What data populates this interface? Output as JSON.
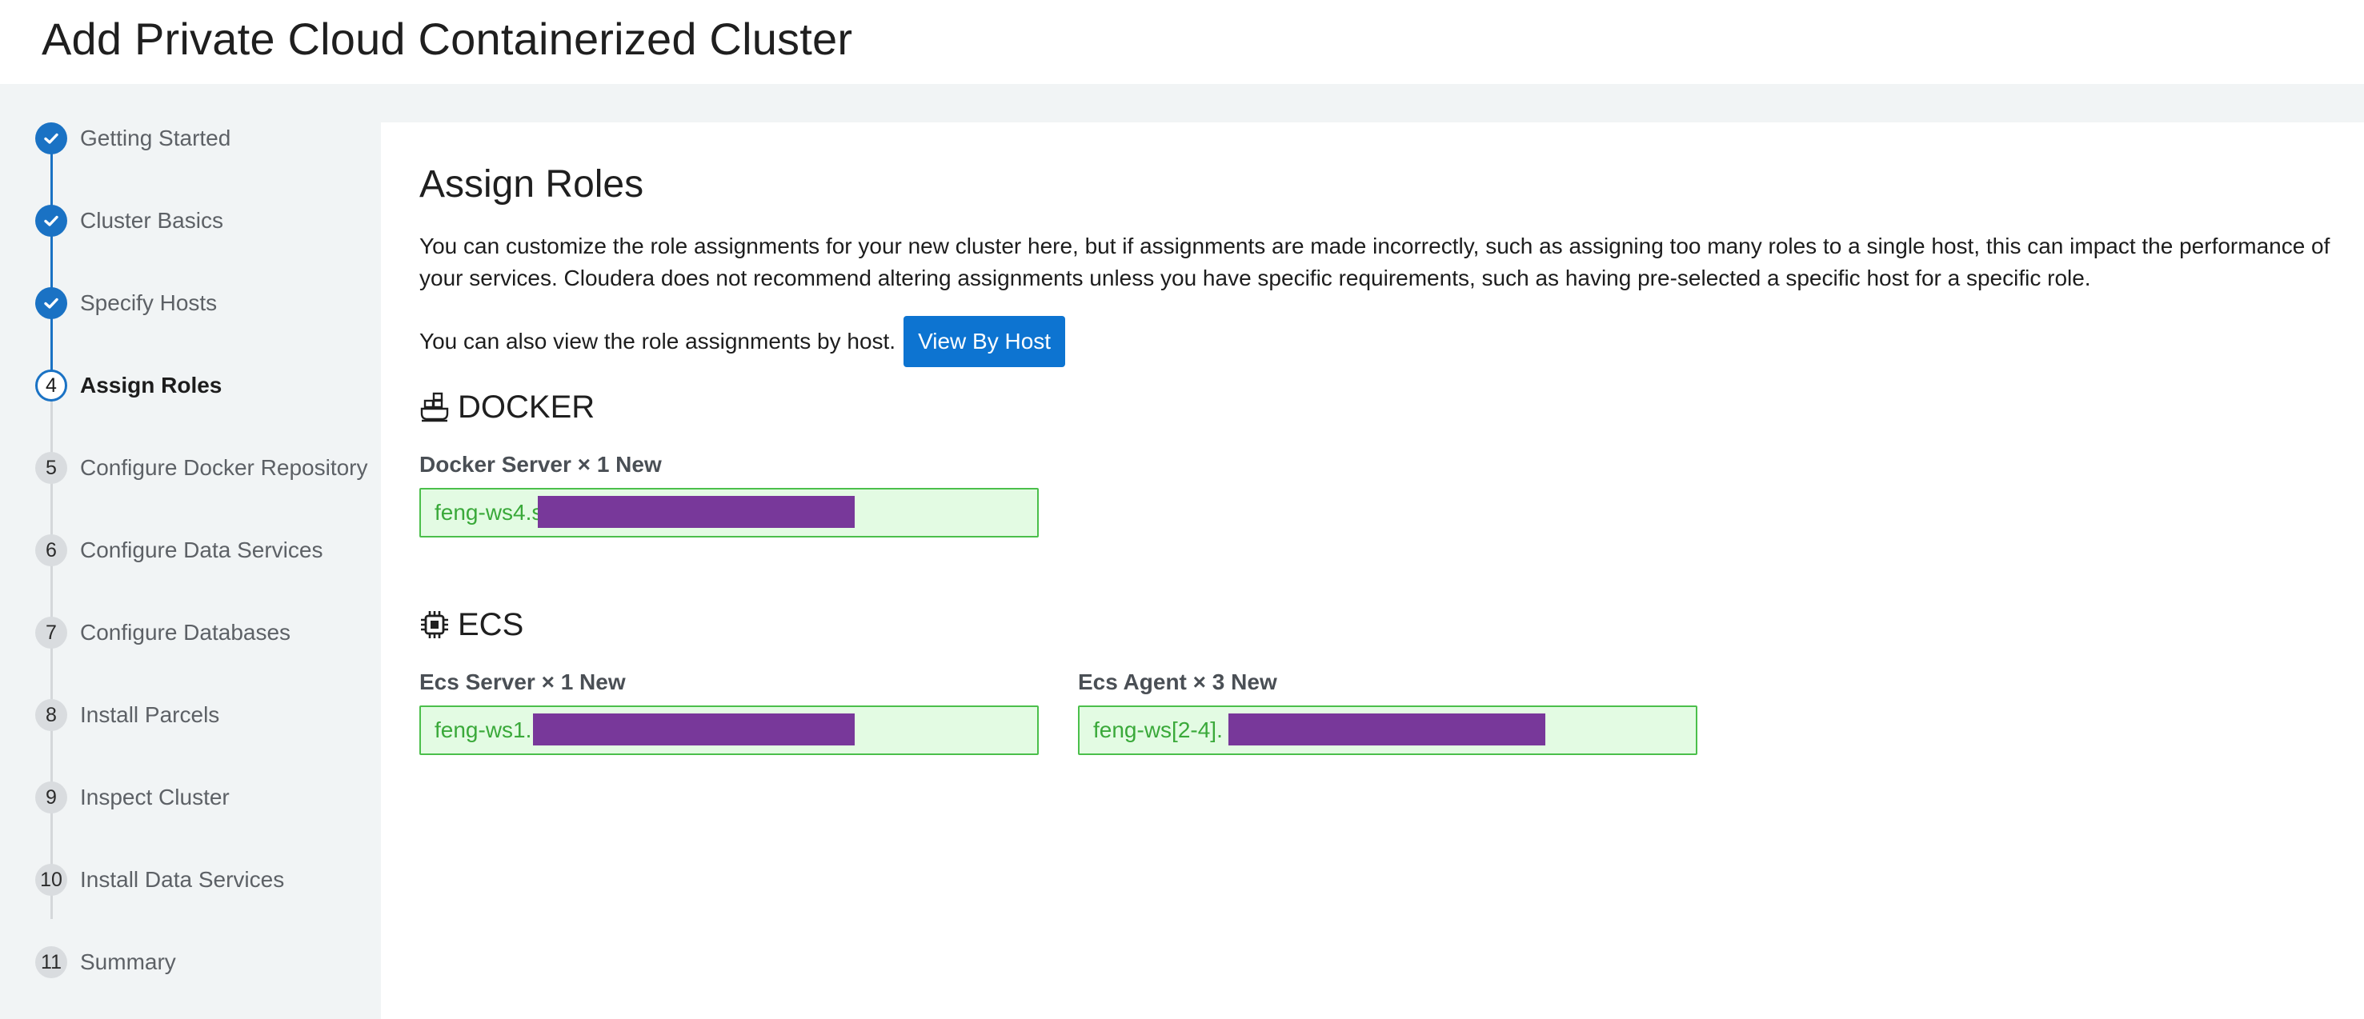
{
  "page": {
    "title": "Add Private Cloud Containerized Cluster"
  },
  "steps": [
    {
      "number": "1",
      "label": "Getting Started",
      "status": "done"
    },
    {
      "number": "2",
      "label": "Cluster Basics",
      "status": "done"
    },
    {
      "number": "3",
      "label": "Specify Hosts",
      "status": "done"
    },
    {
      "number": "4",
      "label": "Assign Roles",
      "status": "current"
    },
    {
      "number": "5",
      "label": "Configure Docker Repository",
      "status": "todo"
    },
    {
      "number": "6",
      "label": "Configure Data Services",
      "status": "todo"
    },
    {
      "number": "7",
      "label": "Configure Databases",
      "status": "todo"
    },
    {
      "number": "8",
      "label": "Install Parcels",
      "status": "todo"
    },
    {
      "number": "9",
      "label": "Inspect Cluster",
      "status": "todo"
    },
    {
      "number": "10",
      "label": "Install Data Services",
      "status": "todo"
    },
    {
      "number": "11",
      "label": "Summary",
      "status": "todo"
    }
  ],
  "main": {
    "title": "Assign Roles",
    "intro": "You can customize the role assignments for your new cluster here, but if assignments are made incorrectly, such as assigning too many roles to a single host, this can impact the performance of your services. Cloudera does not recommend altering assignments unless you have specific requirements, such as having pre-selected a specific host for a specific role.",
    "view_text": "You can also view the role assignments by host.",
    "view_button": "View By Host"
  },
  "services": {
    "docker": {
      "name": "DOCKER",
      "icon": "docker-icon",
      "roles": [
        {
          "label": "Docker Server × 1 New",
          "host": "feng-ws4.s"
        }
      ]
    },
    "ecs": {
      "name": "ECS",
      "icon": "chip-icon",
      "roles": [
        {
          "label": "Ecs Server × 1 New",
          "host": "feng-ws1."
        },
        {
          "label": "Ecs Agent × 3 New",
          "host": "feng-ws[2-4]."
        }
      ]
    }
  },
  "colors": {
    "accent": "#1a72c4",
    "button": "#0d74d1",
    "host_bg": "#e3fbe3",
    "host_border": "#4bbf4b",
    "host_text": "#3aa93a",
    "redaction": "#78389a"
  }
}
